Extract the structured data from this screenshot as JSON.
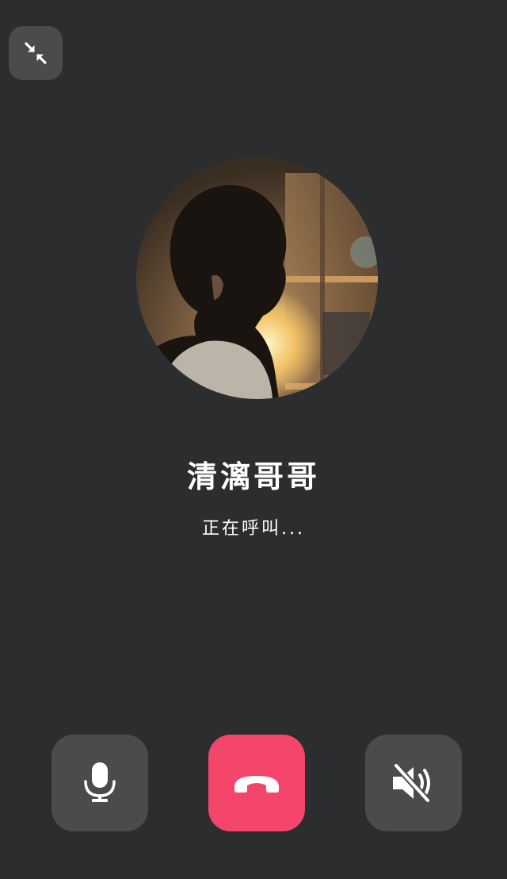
{
  "call": {
    "caller_name": "清漓哥哥",
    "status_text": "正在呼叫..."
  },
  "controls": {
    "minimize_icon": "minimize-arrows-icon",
    "mic_icon": "microphone-icon",
    "hangup_icon": "phone-hangup-icon",
    "speaker_icon": "speaker-muted-icon"
  },
  "colors": {
    "background": "#2b2d2f",
    "button_gray": "#4a4b4d",
    "hangup_red": "#f4466a"
  }
}
